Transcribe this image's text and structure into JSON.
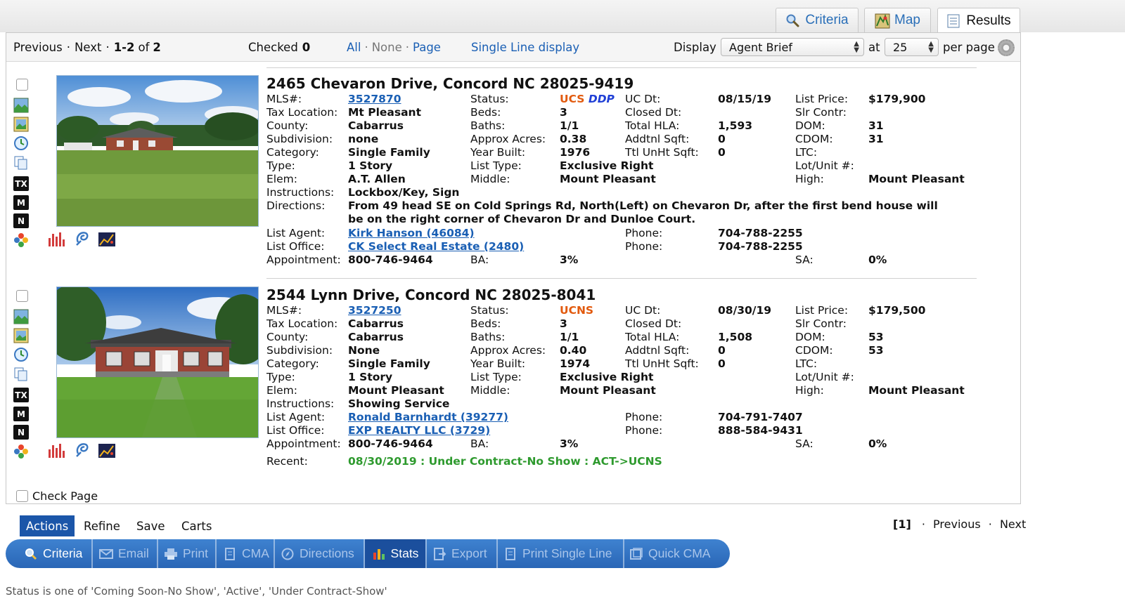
{
  "top_tabs": [
    {
      "label": "Criteria",
      "icon": "search-icon"
    },
    {
      "label": "Map",
      "icon": "map-icon"
    },
    {
      "label": "Results",
      "icon": "list-icon"
    }
  ],
  "nav": {
    "previous": "Previous",
    "sep": "·",
    "next": "Next",
    "range": "1-2",
    "of": "of",
    "total": "2",
    "checked_label": "Checked",
    "checked_count": "0",
    "all": "All",
    "none": "None",
    "page": "Page",
    "single_line": "Single Line display",
    "display_label": "Display",
    "display_value": "Agent Brief",
    "at_label": "at",
    "per_page_value": "25",
    "per_page_label": "per page"
  },
  "labels": {
    "mls": "MLS#:",
    "tax": "Tax Location:",
    "county": "County:",
    "subdivision": "Subdivision:",
    "category": "Category:",
    "type": "Type:",
    "elem": "Elem:",
    "instructions": "Instructions:",
    "directions": "Directions:",
    "list_agent": "List Agent:",
    "list_office": "List Office:",
    "appointment": "Appointment:",
    "recent": "Recent:",
    "status": "Status:",
    "beds": "Beds:",
    "baths": "Baths:",
    "acres": "Approx Acres:",
    "year": "Year Built:",
    "list_type": "List Type:",
    "middle": "Middle:",
    "ba": "BA:",
    "uc_dt": "UC Dt:",
    "closed_dt": "Closed Dt:",
    "hla": "Total HLA:",
    "addtnl": "Addtnl Sqft:",
    "unht": "Ttl UnHt Sqft:",
    "phone": "Phone:",
    "list_price": "List Price:",
    "slr": "Slr Contr:",
    "dom": "DOM:",
    "cdom": "CDOM:",
    "ltc": "LTC:",
    "lot": "Lot/Unit #:",
    "high": "High:",
    "sa": "SA:"
  },
  "listings": [
    {
      "address": "2465 Chevaron Drive, Concord NC 28025-9419",
      "mls": "3527870",
      "tax": "Mt Pleasant",
      "county": "Cabarrus",
      "subdivision": "none",
      "category": "Single Family",
      "type": "1 Story",
      "elem": "A.T. Allen",
      "instructions": "Lockbox/Key, Sign",
      "directions_1": "From 49 head SE on Cold Springs Rd, North(Left) on Chevaron Dr, after the first bend house will",
      "directions_2": "be on the right corner of Chevaron Dr and Dunloe Court.",
      "list_agent": "Kirk Hanson (46084)",
      "list_office": "CK Select Real Estate (2480)",
      "appointment": "800-746-9464",
      "status": "UCS",
      "status_extra": "DDP",
      "beds": "3",
      "baths": "1/1",
      "acres": "0.38",
      "year": "1976",
      "list_type": "Exclusive Right",
      "middle": "Mount Pleasant",
      "ba": "3%",
      "uc_dt": "08/15/19",
      "hla": "1,593",
      "addtnl": "0",
      "unht": "0",
      "agent_phone": "704-788-2255",
      "office_phone": "704-788-2255",
      "list_price": "$179,900",
      "dom": "31",
      "cdom": "31",
      "high": "Mount Pleasant",
      "sa": "0%"
    },
    {
      "address": "2544 Lynn Drive, Concord NC 28025-8041",
      "mls": "3527250",
      "tax": "Cabarrus",
      "county": "Cabarrus",
      "subdivision": "None",
      "category": "Single Family",
      "type": "1 Story",
      "elem": "Mount Pleasant",
      "instructions": "Showing Service",
      "list_agent": "Ronald Barnhardt (39277)",
      "list_office": "EXP REALTY LLC (3729)",
      "appointment": "800-746-9464",
      "recent": "08/30/2019 : Under Contract-No Show : ACT->UCNS",
      "status": "UCNS",
      "beds": "3",
      "baths": "1/1",
      "acres": "0.40",
      "year": "1974",
      "list_type": "Exclusive Right",
      "middle": "Mount Pleasant",
      "ba": "3%",
      "uc_dt": "08/30/19",
      "hla": "1,508",
      "addtnl": "0",
      "unht": "0",
      "agent_phone": "704-791-7407",
      "office_phone": "888-584-9431",
      "list_price": "$179,500",
      "dom": "53",
      "cdom": "53",
      "high": "Mount Pleasant",
      "sa": "0%"
    }
  ],
  "side_icons": {
    "tx": "TX",
    "m": "M",
    "n": "N"
  },
  "check_page": "Check Page",
  "action_tabs": [
    "Actions",
    "Refine",
    "Save",
    "Carts"
  ],
  "pager": {
    "current": "[1]",
    "sep": "·",
    "previous": "Previous",
    "next": "Next"
  },
  "toolbar": [
    {
      "label": "Criteria",
      "icon": "search-icon"
    },
    {
      "label": "Email",
      "icon": "email-icon"
    },
    {
      "label": "Print",
      "icon": "printer-icon"
    },
    {
      "label": "CMA",
      "icon": "document-icon"
    },
    {
      "label": "Directions",
      "icon": "compass-icon"
    },
    {
      "label": "Stats",
      "icon": "bar-chart-icon"
    },
    {
      "label": "Export",
      "icon": "export-icon"
    },
    {
      "label": "Print Single Line",
      "icon": "document-icon"
    },
    {
      "label": "Quick CMA",
      "icon": "quick-cma-icon"
    }
  ],
  "footnote": "Status is one of 'Coming Soon-No Show', 'Active', 'Under Contract-Show'",
  "colors": {
    "link": "#1a5fb4",
    "status_orange": "#e25a0e",
    "status_blue": "#1f3fd6",
    "recent_green": "#2e9a2e",
    "toolbar_blue": "#2f6fc0"
  }
}
